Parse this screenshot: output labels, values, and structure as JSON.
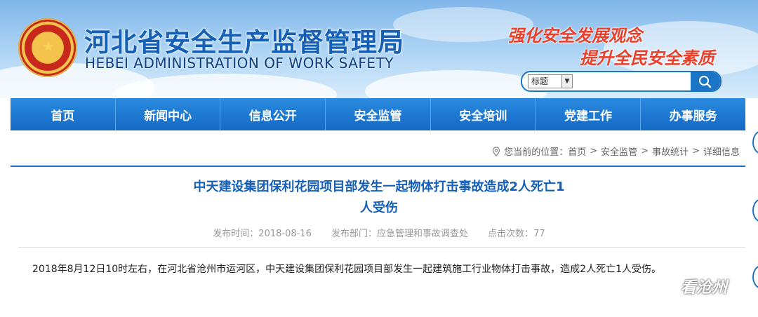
{
  "header": {
    "title": "河北省安全生产监督管理局",
    "subtitle": "HEBEI ADMINISTRATION OF WORK SAFETY",
    "slogans": [
      "强化安全发展观念",
      "提升全民安全素质"
    ],
    "colors": {
      "title": "#1560b6",
      "slogan": "#e8402a",
      "nav": "#1b74c6"
    }
  },
  "search": {
    "select_value": "标题",
    "placeholder": ""
  },
  "nav": {
    "items": [
      "首页",
      "新闻中心",
      "信息公开",
      "安全监管",
      "安全培训",
      "党建工作",
      "办事服务"
    ]
  },
  "breadcrumb": {
    "prefix": "您当前的位置：",
    "items": [
      "首页",
      "安全监管",
      "事故统计",
      "详细信息"
    ],
    "separator": ">"
  },
  "article": {
    "title_line1": "中天建设集团保利花园项目部发生一起物体打击事故造成2人死亡1",
    "title_line2": "人受伤",
    "meta": {
      "date": "发布时间：2018-08-16",
      "department": "发布部门：应急管理和事故调查处",
      "clicks": "点击次数：77"
    },
    "body": "2018年8月12日10时左右，在河北省沧州市运河区，中天建设集团保利花园项目部发生一起建筑施工行业物体打击事故，造成2人死亡1人受伤。"
  },
  "watermark": {
    "text": "看沧州",
    "icon": "wechat-icon"
  }
}
